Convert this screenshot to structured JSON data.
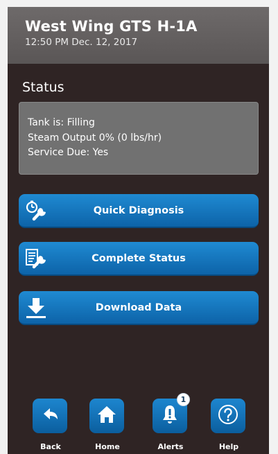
{
  "header": {
    "title": "West Wing GTS H-1A",
    "datetime": "12:50 PM Dec. 12, 2017"
  },
  "section": {
    "title": "Status"
  },
  "status": {
    "tank": "Tank is: Filling",
    "steam": "Steam Output  0% (0 lbs/hr)",
    "service": "Service Due: Yes"
  },
  "actions": {
    "quick_diagnosis": {
      "label": "Quick Diagnosis",
      "icon": "timer-wrench-icon"
    },
    "complete_status": {
      "label": "Complete Status",
      "icon": "document-wrench-icon"
    },
    "download_data": {
      "label": "Download Data",
      "icon": "download-arrow-icon"
    }
  },
  "nav": {
    "back": {
      "label": "Back",
      "icon": "back-arrow-icon"
    },
    "home": {
      "label": "Home",
      "icon": "home-icon"
    },
    "alerts": {
      "label": "Alerts",
      "icon": "bell-icon",
      "badge": "1"
    },
    "help": {
      "label": "Help",
      "icon": "question-mark-icon"
    }
  },
  "colors": {
    "background": "#2f2424",
    "header": "#666262",
    "card": "#717171",
    "accent": "#1479c0"
  }
}
